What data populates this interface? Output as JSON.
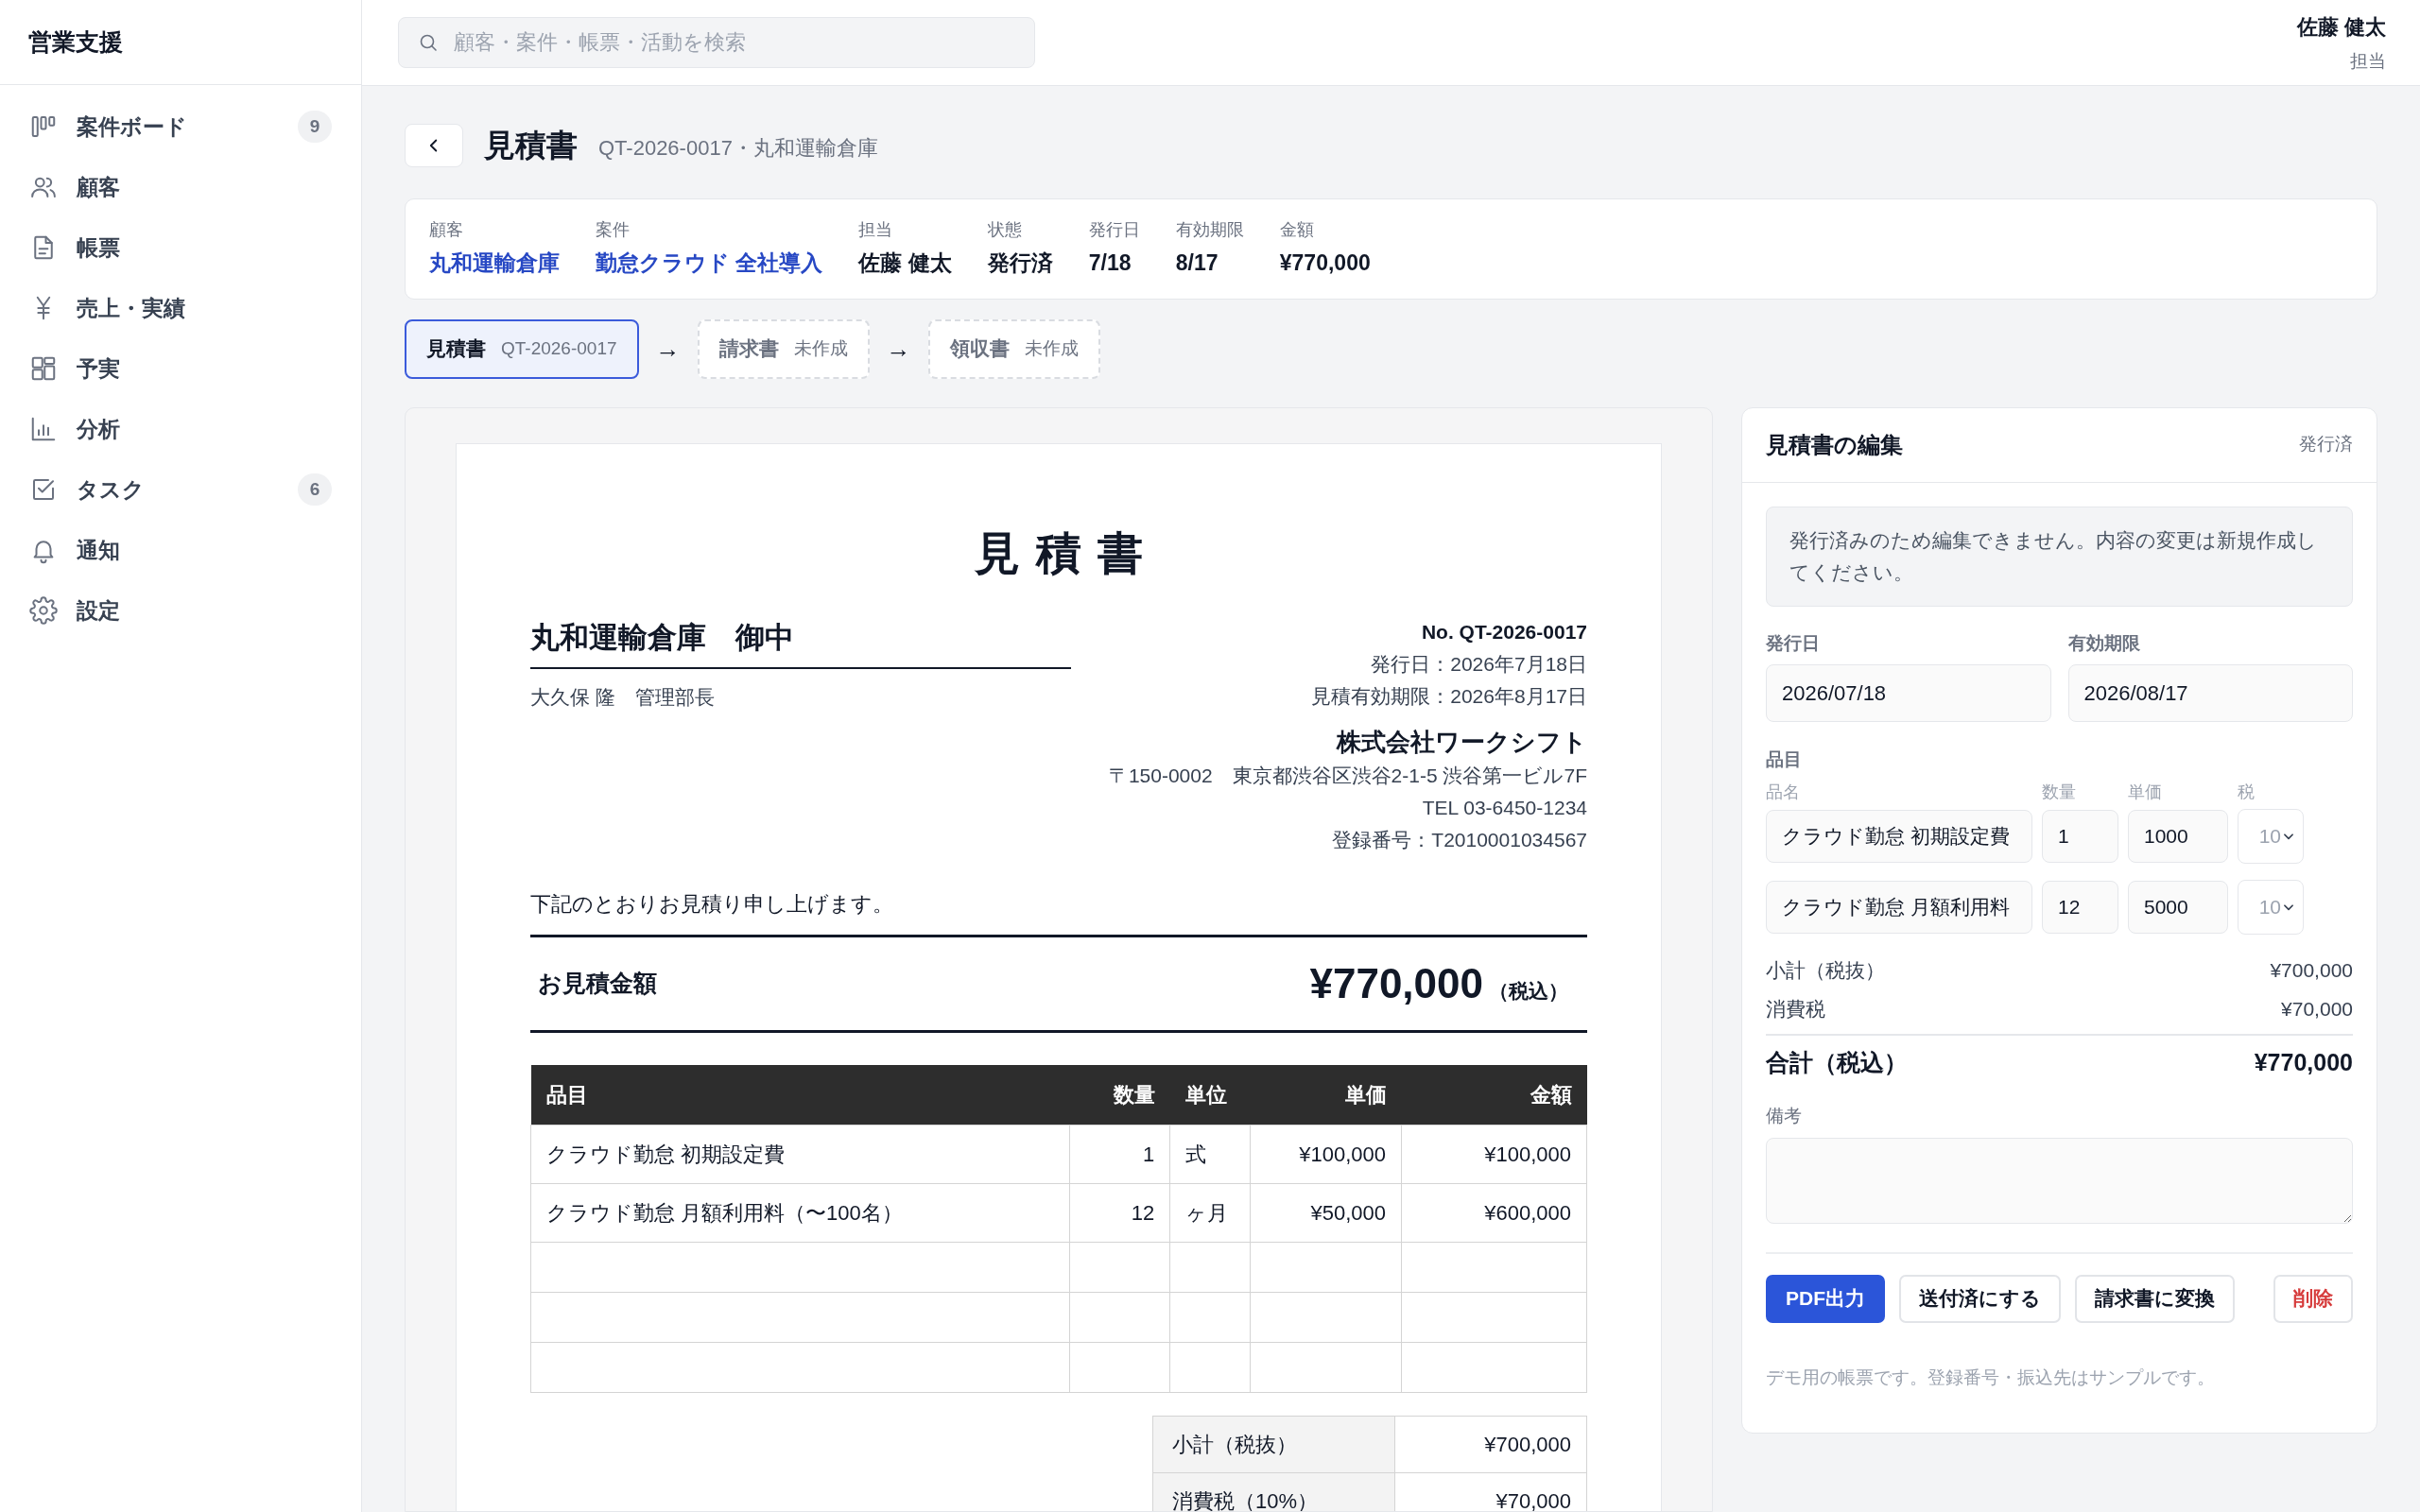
{
  "sidebar": {
    "title": "営業支援",
    "items": [
      {
        "label": "案件ボード",
        "badge": "9"
      },
      {
        "label": "顧客"
      },
      {
        "label": "帳票"
      },
      {
        "label": "売上・実績"
      },
      {
        "label": "予実"
      },
      {
        "label": "分析"
      },
      {
        "label": "タスク",
        "badge": "6"
      },
      {
        "label": "通知"
      },
      {
        "label": "設定"
      }
    ]
  },
  "topbar": {
    "search": {
      "placeholder": "顧客・案件・帳票・活動を検索"
    },
    "user": {
      "name": "佐藤 健太",
      "role": "担当"
    }
  },
  "header": {
    "title": "見積書",
    "subtitle": "QT-2026-0017・丸和運輸倉庫"
  },
  "summary": [
    {
      "label": "顧客",
      "value": "丸和運輸倉庫",
      "link": true
    },
    {
      "label": "案件",
      "value": "勤怠クラウド 全社導入",
      "link": true
    },
    {
      "label": "担当",
      "value": "佐藤 健太",
      "link": false
    },
    {
      "label": "状態",
      "value": "発行済",
      "link": false
    },
    {
      "label": "発行日",
      "value": "7/18",
      "link": false
    },
    {
      "label": "有効期限",
      "value": "8/17",
      "link": false
    },
    {
      "label": "金額",
      "value": "¥770,000",
      "link": false
    }
  ],
  "flow": [
    {
      "label": "見積書",
      "detail": "QT-2026-0017",
      "selected": true,
      "arrow_after": "→"
    },
    {
      "label": "請求書",
      "detail": "未作成",
      "selected": false,
      "arrow_after": "→"
    },
    {
      "label": "領収書",
      "detail": "未作成",
      "selected": false
    }
  ],
  "document": {
    "title": "見積書",
    "recipient": "丸和運輸倉庫　御中",
    "contact": "大久保 隆　管理部長",
    "number": "No. QT-2026-0017",
    "issue_date": "発行日：2026年7月18日",
    "expiry": "見積有効期限：2026年8月17日",
    "company": "株式会社ワークシフト",
    "address": "〒150-0002　東京都渋谷区渋谷2-1-5 渋谷第一ビル7F",
    "tel": "TEL 03-6450-1234",
    "registration": "登録番号：T2010001034567",
    "intro": "下記のとおりお見積り申し上げます。",
    "total_label": "お見積金額",
    "total": "¥770,000",
    "total_note": "（税込）",
    "columns": [
      "品目",
      "数量",
      "単位",
      "単価",
      "金額"
    ],
    "rows": [
      {
        "kind": "item",
        "cells": [
          "クラウド勤怠 初期設定費",
          "1",
          "式",
          "¥100,000",
          "¥100,000"
        ]
      },
      {
        "kind": "item",
        "cells": [
          "クラウド勤怠 月額利用料（〜100名）",
          "12",
          "ヶ月",
          "¥50,000",
          "¥600,000"
        ]
      },
      {
        "kind": "blank"
      },
      {
        "kind": "blank"
      },
      {
        "kind": "blank"
      }
    ],
    "totals": [
      {
        "label": "小計（税抜）",
        "value": "¥700,000"
      },
      {
        "label": "消費税（10%）",
        "value": "¥70,000"
      }
    ]
  },
  "editor": {
    "title": "見積書の編集",
    "status": "発行済",
    "notice": "発行済みのため編集できません。内容の変更は新規作成してください。",
    "fields": [
      {
        "label": "発行日",
        "value": "2026/07/18"
      },
      {
        "label": "有効期限",
        "value": "2026/08/17"
      }
    ],
    "items_label": "品目",
    "item_columns": [
      "品名",
      "数量",
      "単価",
      "税"
    ],
    "items": [
      {
        "name": "クラウド勤怠 初期設定費",
        "quantity": "1",
        "price": "1000",
        "tax": "10"
      },
      {
        "name": "クラウド勤怠 月額利用料",
        "quantity": "12",
        "price": "5000",
        "tax": "10"
      }
    ],
    "subtotal": {
      "label": "小計（税抜）",
      "value": "¥700,000"
    },
    "tax": {
      "label": "消費税",
      "value": "¥70,000"
    },
    "total": {
      "label": "合計（税込）",
      "value": "¥770,000"
    },
    "notes_label": "備考",
    "actions": [
      {
        "label": "PDF出力",
        "kind": "primary"
      },
      {
        "label": "送付済にする",
        "kind": "default"
      },
      {
        "label": "請求書に変換",
        "kind": "default"
      },
      {
        "label": "削除",
        "kind": "danger"
      }
    ],
    "footnote": "デモ用の帳票です。登録番号・振込先はサンプルです。"
  }
}
